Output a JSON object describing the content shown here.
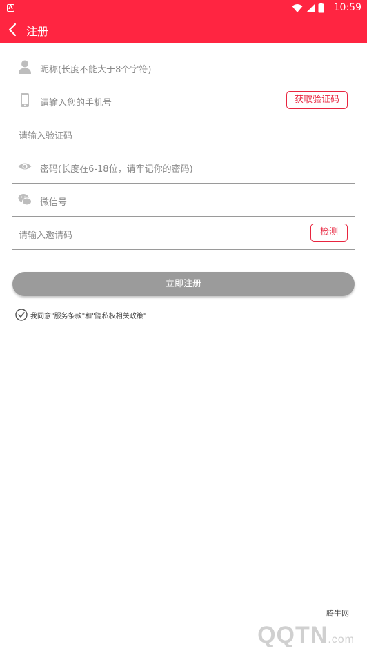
{
  "status_bar": {
    "time": "10:59"
  },
  "header": {
    "title": "注册"
  },
  "form": {
    "nickname_placeholder": "昵称(长度不能大于8个字符)",
    "phone_placeholder": "请输入您的手机号",
    "get_code_label": "获取验证码",
    "code_placeholder": "请输入验证码",
    "password_placeholder": "密码(长度在6-18位，请牢记你的密码)",
    "wechat_placeholder": "微信号",
    "invite_placeholder": "请输入邀请码",
    "check_label": "检测"
  },
  "register_label": "立即注册",
  "agreement_text": "我同意\"服务条款\"和\"隐私权相关政策\"",
  "watermark": {
    "site_name": "腾牛网",
    "logo_text": "QQTN",
    "logo_suffix": ".com"
  },
  "colors": {
    "brand": "#ff2541",
    "button_disabled": "#9b9b9b"
  },
  "icons": [
    "user-icon",
    "phone-icon",
    "eye-icon",
    "wechat-icon",
    "check-circle-icon",
    "back-arrow-icon"
  ]
}
